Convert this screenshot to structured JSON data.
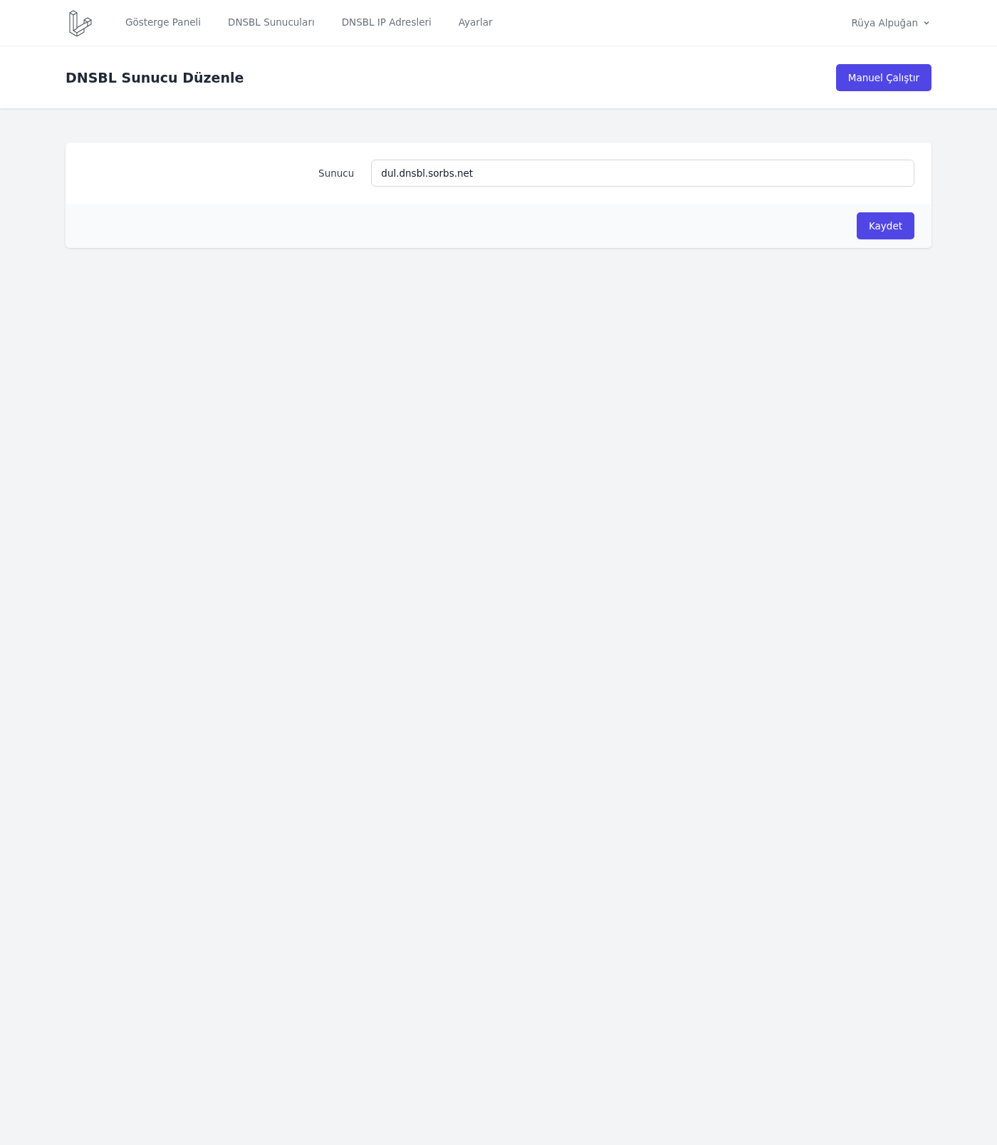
{
  "nav": {
    "items": [
      {
        "label": "Gösterge Paneli",
        "selected": false
      },
      {
        "label": "DNSBL Sunucuları",
        "selected": false
      },
      {
        "label": "DNSBL IP Adresleri",
        "selected": false
      },
      {
        "label": "Ayarlar",
        "selected": false
      }
    ],
    "user": "Rüya Alpuğan"
  },
  "header": {
    "title": "DNSBL Sunucu Düzenle",
    "action": "Manuel Çalıştır"
  },
  "form": {
    "label": "Sunucu",
    "value": "dul.dnsbl.sorbs.net",
    "submit": "Kaydet"
  }
}
